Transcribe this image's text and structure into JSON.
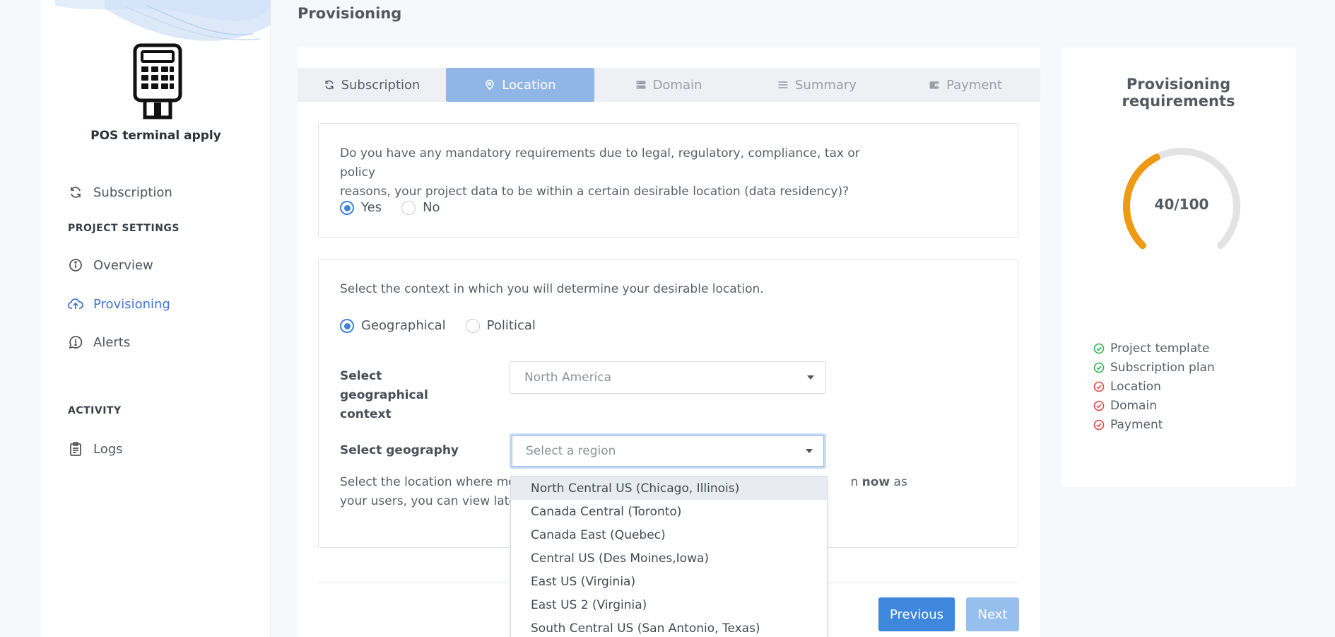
{
  "page": {
    "title": "Provisioning"
  },
  "sidebar": {
    "app_name": "POS terminal apply",
    "items": [
      {
        "label": "Subscription",
        "icon": "refresh-icon"
      },
      {
        "label": "Overview",
        "icon": "info-icon"
      },
      {
        "label": "Provisioning",
        "icon": "cloud-upload-icon",
        "active": true
      },
      {
        "label": "Alerts",
        "icon": "chat-bubble-icon"
      },
      {
        "label": "Logs",
        "icon": "clipboard-icon"
      }
    ],
    "sections": {
      "project_settings": "PROJECT SETTINGS",
      "activity": "ACTIVITY"
    }
  },
  "tabs": [
    {
      "label": "Subscription",
      "icon": "refresh-icon"
    },
    {
      "label": "Location",
      "icon": "map-pin-icon"
    },
    {
      "label": "Domain",
      "icon": "server-icon"
    },
    {
      "label": "Summary",
      "icon": "list-icon"
    },
    {
      "label": "Payment",
      "icon": "wallet-icon"
    }
  ],
  "residency": {
    "question_line1": "Do you have any mandatory requirements due to legal, regulatory, compliance, tax or policy",
    "question_line2": "reasons, your project data to be within a certain desirable location (data residency)?",
    "options": [
      "Yes",
      "No"
    ],
    "selected": "Yes"
  },
  "context": {
    "prompt": "Select the context in which you will determine your desirable location.",
    "options": [
      "Geographical",
      "Political"
    ],
    "selected": "Geographical",
    "geo_context_label": "Select geographical context",
    "geo_context_value": "North America",
    "geography_label": "Select geography",
    "geography_placeholder": "Select a region",
    "hint_line1_start": "Select the location where mos",
    "hint_line1_bold": "now",
    "hint_line1_end": " as",
    "hint_line1_mid": "n",
    "hint_line2": "your users, you can view laten"
  },
  "dropdown": {
    "options": [
      "North Central US (Chicago, Illinois)",
      "Canada Central (Toronto)",
      "Canada East (Quebec)",
      "Central US (Des Moines,Iowa)",
      "East US (Virginia)",
      "East US 2 (Virginia)",
      "South Central US (San Antonio, Texas)"
    ],
    "highlighted_index": 0
  },
  "buttons": {
    "previous": "Previous",
    "next": "Next"
  },
  "requirements": {
    "title_line1": "Provisioning",
    "title_line2": "requirements",
    "score_text": "40/100",
    "score_fraction": 0.4,
    "items": [
      {
        "label": "Project template",
        "status": "done"
      },
      {
        "label": "Subscription plan",
        "status": "done"
      },
      {
        "label": "Location",
        "status": "pending"
      },
      {
        "label": "Domain",
        "status": "pending"
      },
      {
        "label": "Payment",
        "status": "pending"
      }
    ],
    "colors": {
      "done": "#2fb34a",
      "pending": "#e2463c",
      "gauge": "#ee9a12",
      "track": "#e3e3e3"
    }
  }
}
